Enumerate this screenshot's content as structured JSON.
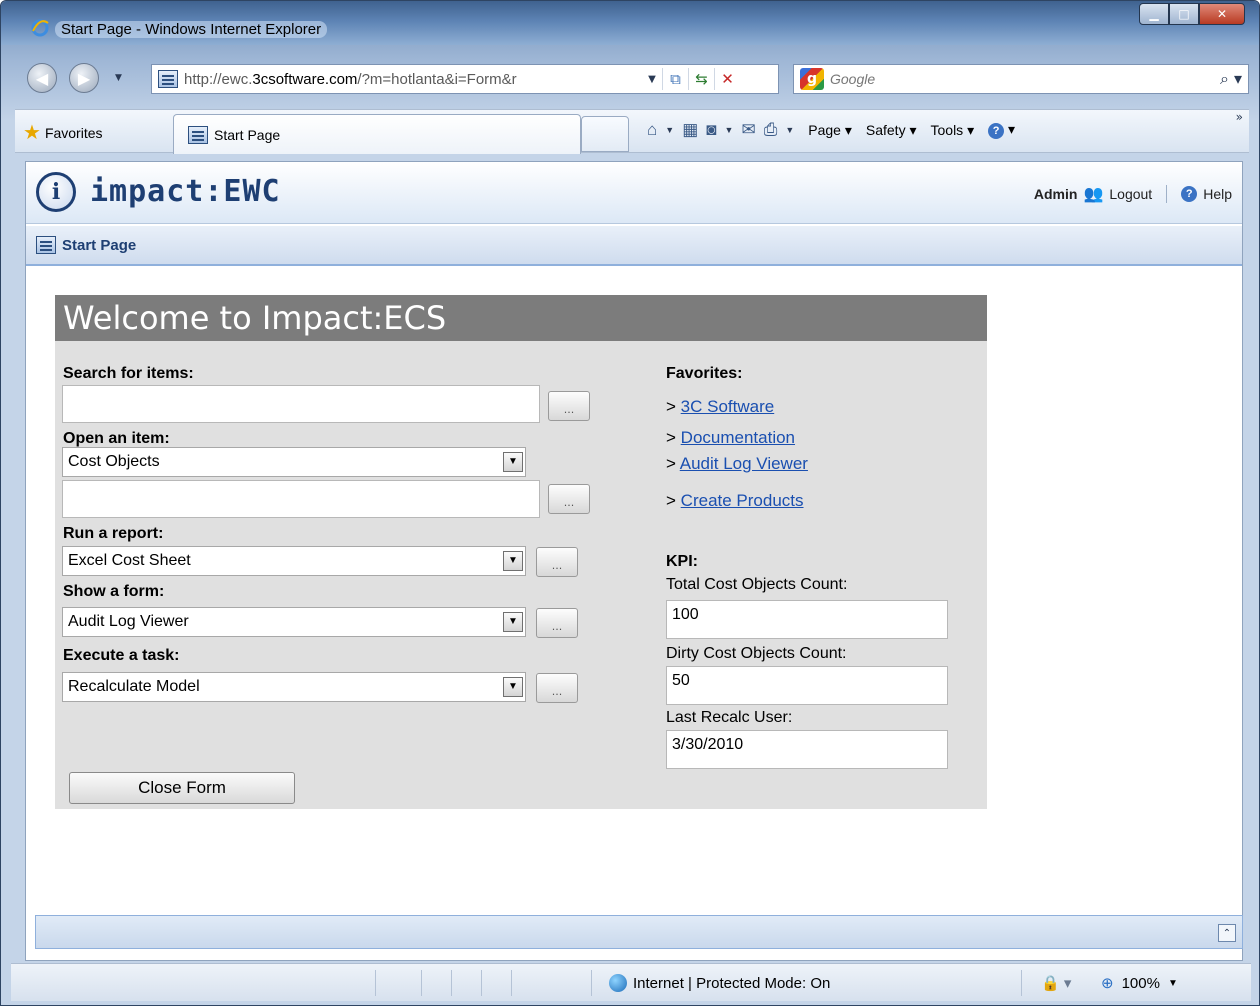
{
  "window": {
    "title": "Start Page - Windows Internet Explorer"
  },
  "browser": {
    "url_prefix": "http://ewc.",
    "url_domain": "3csoftware.com",
    "url_rest": "/?m=hotlanta&i=Form&r",
    "search_placeholder": "Google",
    "favorites_label": "Favorites",
    "tab_title": "Start Page",
    "menus": [
      "Page",
      "Safety",
      "Tools"
    ]
  },
  "app": {
    "logo_text": "impact:EWC",
    "user": "Admin",
    "logout_label": "Logout",
    "help_label": "Help",
    "breadcrumb": "Start Page"
  },
  "form": {
    "title": "Welcome to Impact:ECS",
    "search_label": "Search for items:",
    "search_value": "",
    "open_label": "Open an item:",
    "open_select": "Cost Objects",
    "open_value": "",
    "report_label": "Run a report:",
    "report_select": "Excel Cost Sheet",
    "form_label": "Show a form:",
    "form_select": "Audit Log Viewer",
    "task_label": "Execute a task:",
    "task_select": "Recalculate Model",
    "ellipsis": "...",
    "close_button": "Close Form",
    "favorites_label": "Favorites:",
    "favorites": [
      {
        "prefix": ">",
        "label": "3C Software"
      },
      {
        "prefix": ">",
        "label": "Documentation"
      },
      {
        "prefix": ">",
        "label": "Audit Log Viewer"
      },
      {
        "prefix": ">",
        "label": "Create Products"
      }
    ],
    "kpi_label": "KPI:",
    "kpi": [
      {
        "label": "Total Cost Objects Count:",
        "value": "100"
      },
      {
        "label": "Dirty Cost Objects Count:",
        "value": "50"
      },
      {
        "label": "Last Recalc User:",
        "value": "3/30/2010"
      }
    ]
  },
  "status": {
    "zone": "Internet | Protected Mode: On",
    "zoom": "100%"
  }
}
